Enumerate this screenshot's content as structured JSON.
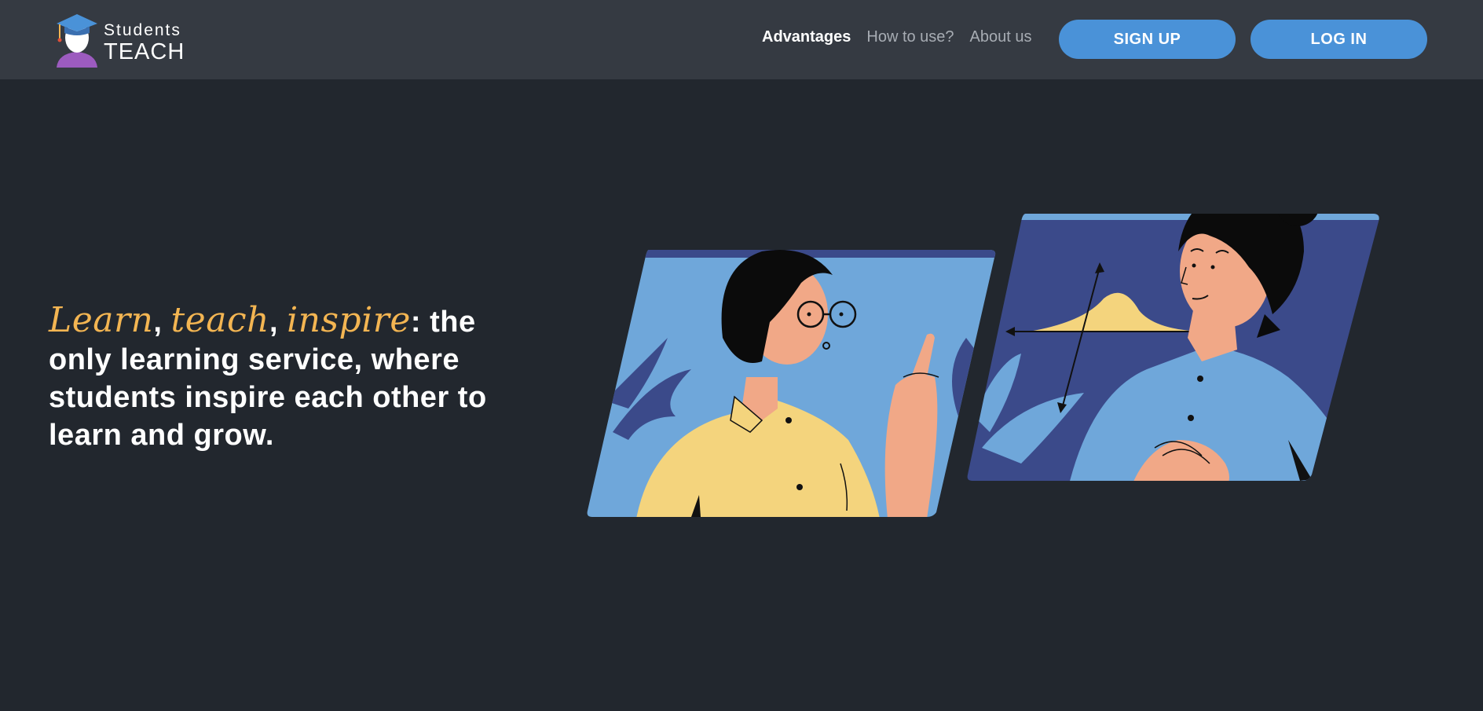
{
  "brand": {
    "top_text": "Students",
    "bottom_text": "TEACH"
  },
  "nav": {
    "items": [
      {
        "label": "Advantages",
        "active": true
      },
      {
        "label": "How to use?",
        "active": false
      },
      {
        "label": "About us",
        "active": false
      }
    ]
  },
  "actions": {
    "signup_label": "SIGN UP",
    "login_label": "LOG IN"
  },
  "hero": {
    "word1": "Learn",
    "word2": "teach",
    "word3": "inspire",
    "sep1": ", ",
    "sep2": ", ",
    "rest": ": the only learning service, where students inspire each other to learn and grow."
  },
  "colors": {
    "page_background": "#22272e",
    "header_background": "#353a42",
    "button": "#4a92d8",
    "accent": "#f3b552"
  },
  "icons": {
    "logo": "graduate-avatar-icon"
  }
}
